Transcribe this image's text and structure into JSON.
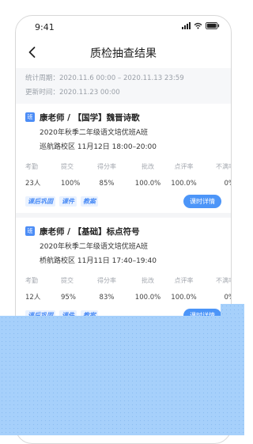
{
  "status_bar": {
    "time": "9:41",
    "icons": [
      "signal-icon",
      "wifi-icon",
      "battery-icon"
    ]
  },
  "nav": {
    "back_icon": "chevron-left-icon",
    "title": "质检抽查结果"
  },
  "period": {
    "stat_period": "统计周期：2020.11.6 00:00 – 2020.11.13 23:59",
    "updated": "更新时间：2020.11.23 00:00"
  },
  "stat_headers": [
    "考勤",
    "提交",
    "得分率",
    "批改",
    "点评率",
    "不满率"
  ],
  "cards": [
    {
      "badge": "班",
      "teacher": "康老师  /  【国学】魏晋诗歌",
      "class_name": "2020年秋季二年级语文培优班A班",
      "schedule": "巡航路校区  11月12日 18:00–20:00",
      "values": [
        "23人",
        "100%",
        "85%",
        "100.0%",
        "100.0%",
        "0%"
      ],
      "tags": [
        "课后巩固",
        "课件",
        "教案"
      ],
      "detail_button": "课时详情"
    },
    {
      "badge": "班",
      "teacher": "康老师  /  【基础】标点符号",
      "class_name": "2020年秋季二年级语文培优班A班",
      "schedule": "桥航路校区  11月11日 17:40–19:40",
      "values": [
        "12人",
        "95%",
        "83%",
        "100.0%",
        "100.0%",
        "0%"
      ],
      "tags": [
        "课后巩固",
        "课件",
        "教案"
      ],
      "detail_button": "课时详情"
    }
  ],
  "colors": {
    "accent": "#4c8df6",
    "overlay": "#a6d0fb",
    "muted": "#9aa0a8"
  }
}
